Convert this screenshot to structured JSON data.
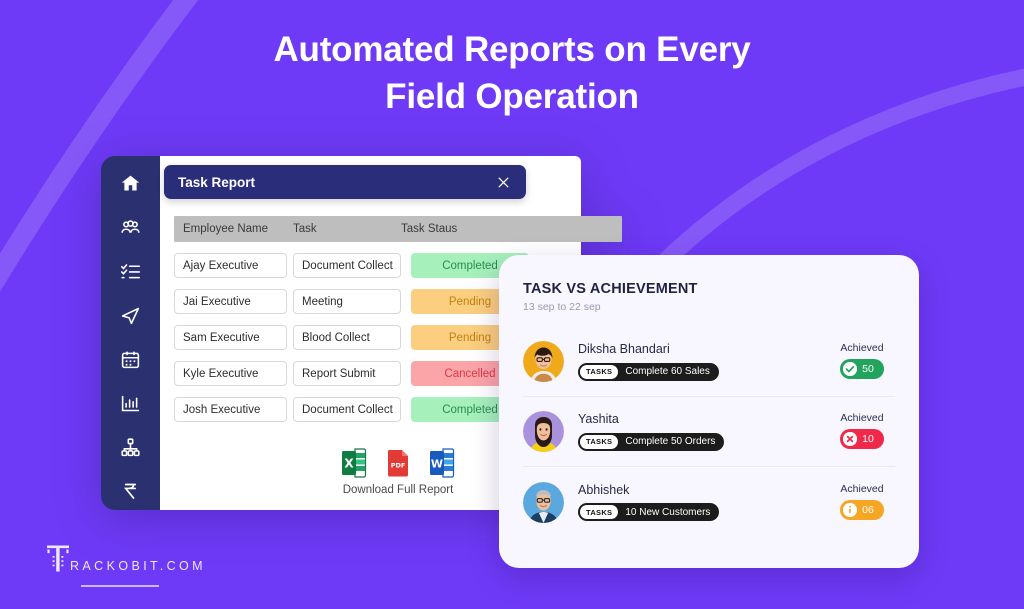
{
  "theme": {
    "background": "#6E3AF7",
    "sidebar": "#2A3070",
    "modal_header": "#2A2E7A",
    "card_background": "#F8F6FE",
    "accent_green": "#22A45D",
    "accent_red": "#F02849",
    "accent_orange": "#F5A623"
  },
  "headline": {
    "line1": "Automated Reports on Every",
    "line2": "Field Operation"
  },
  "sidebar": {
    "items": [
      {
        "name": "home-icon",
        "label": "Home"
      },
      {
        "name": "users-icon",
        "label": "Users"
      },
      {
        "name": "checklist-icon",
        "label": "Tasks"
      },
      {
        "name": "send-icon",
        "label": "Dispatch"
      },
      {
        "name": "calendar-icon",
        "label": "Calendar"
      },
      {
        "name": "bar-chart-icon",
        "label": "Reports"
      },
      {
        "name": "sitemap-icon",
        "label": "Hierarchy"
      },
      {
        "name": "rupee-icon",
        "label": "Expenses"
      }
    ]
  },
  "task_report": {
    "title": "Task Report",
    "close_label": "Close",
    "columns": [
      "Employee Name",
      "Task",
      "Task Staus"
    ],
    "rows": [
      {
        "employee": "Ajay Executive",
        "task": "Document Collect",
        "status": "Completed",
        "status_kind": "completed"
      },
      {
        "employee": "Jai Executive",
        "task": "Meeting",
        "status": "Pending",
        "status_kind": "pending"
      },
      {
        "employee": "Sam Executive",
        "task": "Blood Collect",
        "status": "Pending",
        "status_kind": "pending"
      },
      {
        "employee": "Kyle Executive",
        "task": "Report Submit",
        "status": "Cancelled",
        "status_kind": "cancelled"
      },
      {
        "employee": "Josh Executive",
        "task": "Document Collect",
        "status": "Completed",
        "status_kind": "completed"
      }
    ],
    "download": {
      "label": "Download Full Report",
      "formats": [
        "excel",
        "pdf",
        "word"
      ]
    }
  },
  "achievement": {
    "title": "TASK VS ACHIEVEMENT",
    "date_range": "13 sep to 22 sep",
    "achieved_label": "Achieved",
    "tasks_tag": "TASKS",
    "rows": [
      {
        "name": "Diksha Bhandari",
        "task": "Complete 60 Sales",
        "value": "50",
        "kind": "green",
        "avatar": "avatar-diksha"
      },
      {
        "name": "Yashita",
        "task": "Complete 50 Orders",
        "value": "10",
        "kind": "red",
        "avatar": "avatar-yashita"
      },
      {
        "name": "Abhishek",
        "task": "10 New Customers",
        "value": "06",
        "kind": "orange",
        "avatar": "avatar-abhishek"
      }
    ]
  },
  "logo": {
    "text": "RACKOBIT.COM"
  }
}
